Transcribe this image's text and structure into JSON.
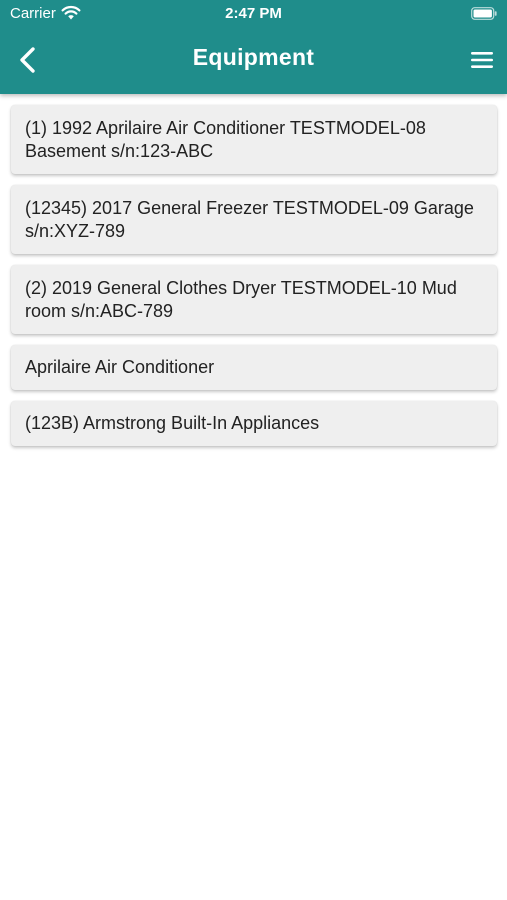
{
  "status_bar": {
    "carrier": "Carrier",
    "time": "2:47 PM"
  },
  "header": {
    "title": "Equipment",
    "back_icon": "chevron-left-icon",
    "menu_icon": "hamburger-menu-icon",
    "background": "#1f8d8b"
  },
  "equipment": [
    {
      "label": "(1) 1992 Aprilaire Air Conditioner TESTMODEL-08 Basement s/n:123-ABC"
    },
    {
      "label": "(12345) 2017 General Freezer TESTMODEL-09 Garage s/n:XYZ-789"
    },
    {
      "label": "(2) 2019 General Clothes Dryer TESTMODEL-10 Mud room s/n:ABC-789"
    },
    {
      "label": "Aprilaire Air Conditioner"
    },
    {
      "label": "(123B) Armstrong Built-In Appliances"
    }
  ]
}
